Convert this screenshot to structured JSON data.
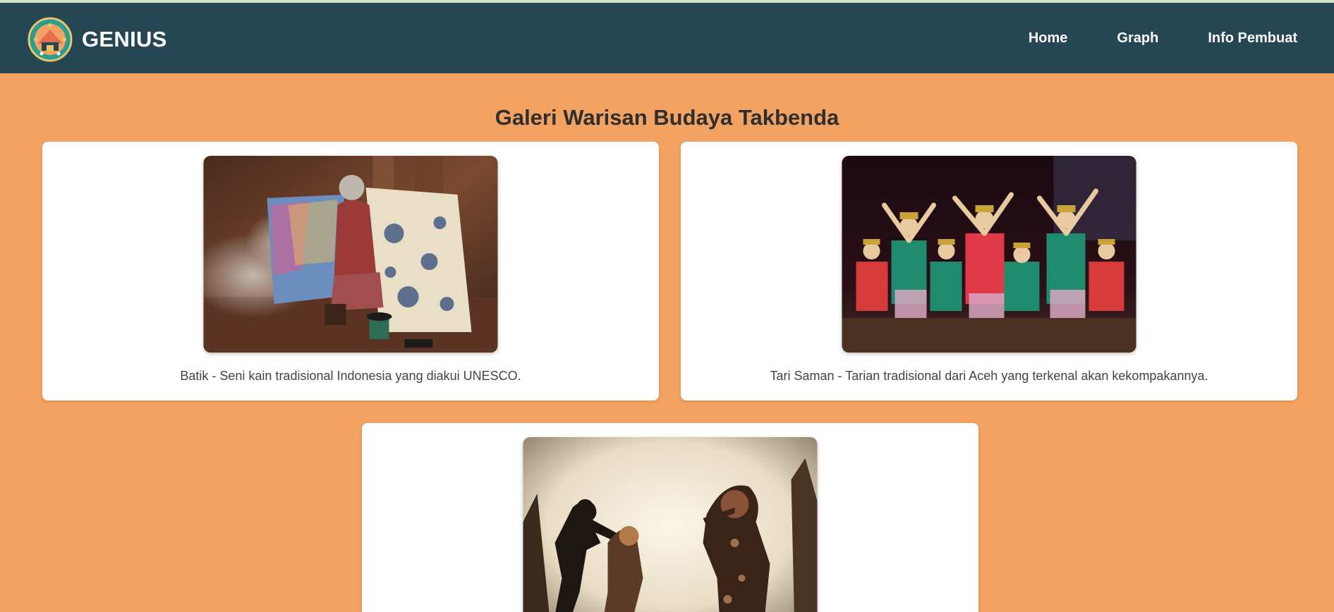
{
  "header": {
    "brand": "GENIUS",
    "logo_icon": "cultural-emblem-icon",
    "nav": [
      {
        "label": "Home"
      },
      {
        "label": "Graph"
      },
      {
        "label": "Info Pembuat"
      }
    ],
    "bg_color": "#264653"
  },
  "main": {
    "title": "Galeri Warisan Budaya Takbenda",
    "bg_color": "#f4a261",
    "cards": [
      {
        "image": "batik-photo",
        "caption": "Batik - Seni kain tradisional Indonesia yang diakui UNESCO."
      },
      {
        "image": "tari-saman-photo",
        "caption": "Tari Saman - Tarian tradisional dari Aceh yang terkenal akan kekompakannya."
      },
      {
        "image": "wayang-photo",
        "caption": ""
      }
    ]
  }
}
